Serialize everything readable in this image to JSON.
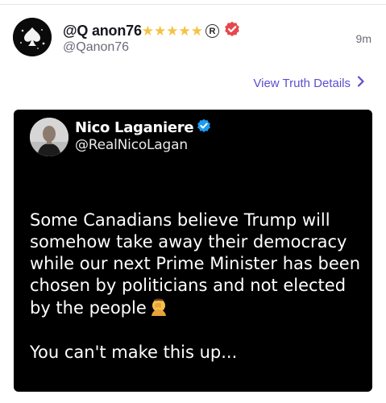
{
  "post": {
    "display_name": "@Q anon76",
    "stars": [
      "★",
      "★",
      "★",
      "★",
      "★"
    ],
    "registered_mark": "R",
    "handle": "@Qanon76",
    "timestamp": "9m",
    "details_link": "View Truth Details",
    "accent_color": "#5a4fcf",
    "verified_color": "#e5484d"
  },
  "embedded_post": {
    "name": "Nico Laganiere",
    "handle": "@RealNicoLagan",
    "verified_color": "#1d9bf0",
    "paragraph_1": "Some Canadians believe Trump will somehow take away their democracy while our next Prime Minister has been chosen by politicians and not elected by the people",
    "paragraph_2": "You can't make this up..."
  }
}
